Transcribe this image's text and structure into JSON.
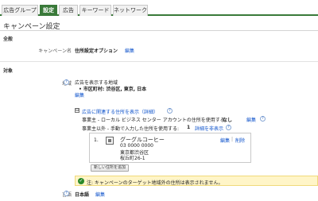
{
  "tabs": [
    "広告グループ",
    "設定",
    "広告",
    "キーワード",
    "ネットワーク"
  ],
  "page_title": "キャンペーン設定",
  "sections": {
    "general": "全般",
    "targeting": "対象"
  },
  "campaign": {
    "label": "キャンペーン名",
    "value": "住所設定オプション",
    "edit": "編集"
  },
  "region": {
    "label": "地域",
    "heading": "広告を表示する地域",
    "bullet": "• 市区町村: 渋谷区, 東京, 日本",
    "edit": "編集"
  },
  "extensions": {
    "toggle": "⊟",
    "title": "広告に関連する住所を表示（詳細）",
    "row1_text": "事業主 - ローカル ビジネス センター アカウントの住所を使用する:",
    "row1_value": "なし",
    "row1_edit": "編集",
    "row2_text": "事業主以外 - 手動で入力した住所を使用する:",
    "row2_value": "1",
    "row2_link": "詳細を非表示",
    "location": {
      "index": "1.",
      "name": "グーグルコーヒー",
      "phone": "03 0000 0000",
      "line1": "東京都渋谷区",
      "line2": "桜丘町26-1",
      "edit": "編集",
      "separator": "|",
      "delete": "削除"
    },
    "add_button": "新しい住所を追加"
  },
  "notice": "注: キャンペーンのターゲット地域外の住所は表示されません。",
  "language": {
    "label": "言語",
    "value": "日本語",
    "edit": "編集"
  },
  "help_glyph": "?"
}
